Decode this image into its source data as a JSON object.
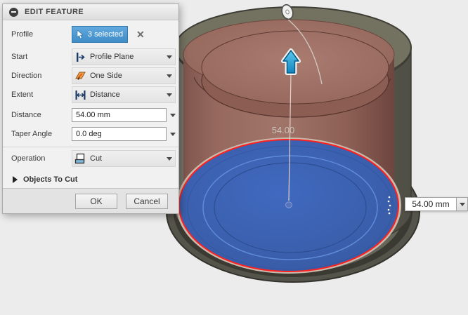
{
  "dialog": {
    "title": "EDIT FEATURE",
    "profile": {
      "label": "Profile",
      "value": "3 selected",
      "clear": "✕"
    },
    "start": {
      "label": "Start",
      "value": "Profile Plane"
    },
    "direction": {
      "label": "Direction",
      "value": "One Side"
    },
    "extent": {
      "label": "Extent",
      "value": "Distance"
    },
    "distance": {
      "label": "Distance",
      "value": "54.00 mm"
    },
    "taper": {
      "label": "Taper Angle",
      "value": "0.0 deg"
    },
    "operation": {
      "label": "Operation",
      "value": "Cut"
    },
    "objects_to_cut": {
      "label": "Objects To Cut"
    },
    "buttons": {
      "ok": "OK",
      "cancel": "Cancel"
    }
  },
  "viewport": {
    "dimension_label": "54.00",
    "floating_input": {
      "value": "54.00 mm"
    },
    "colors": {
      "selection_fill": "#3c63b4",
      "selection_outline": "#ff2020",
      "body_brown": "#9a6a60",
      "base_gray": "#55544a",
      "arrow_blue": "#29a8e0",
      "background": "#ececec"
    }
  }
}
